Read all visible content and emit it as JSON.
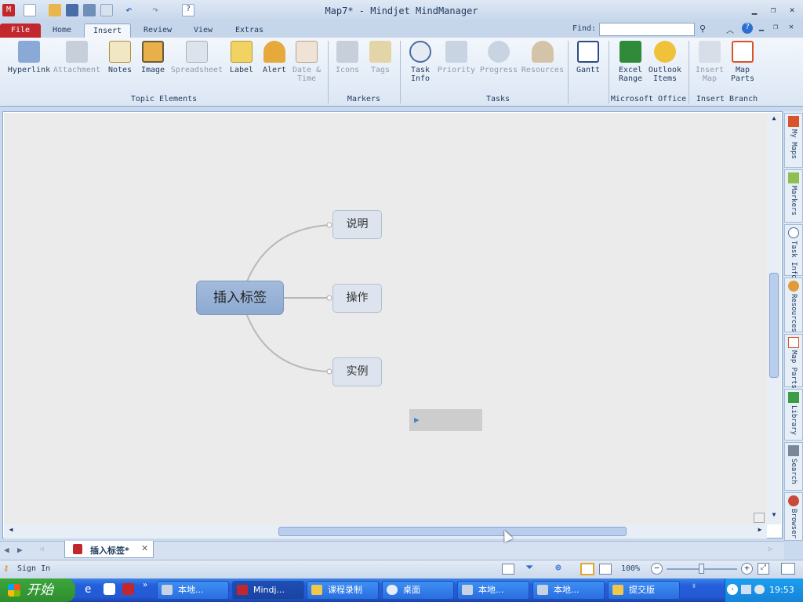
{
  "window": {
    "title": "Map7* - Mindjet MindManager",
    "find_label": "Find:",
    "find_value": ""
  },
  "tabs": [
    {
      "label": "File"
    },
    {
      "label": "Home"
    },
    {
      "label": "Insert"
    },
    {
      "label": "Review"
    },
    {
      "label": "View"
    },
    {
      "label": "Extras"
    }
  ],
  "ribbon": {
    "buttons": [
      {
        "label": "Hyperlink",
        "icon": "chain-link-icon",
        "enabled": true
      },
      {
        "label": "Attachment",
        "icon": "paperclip-icon",
        "enabled": false
      },
      {
        "label": "Notes",
        "icon": "notepad-icon",
        "enabled": true
      },
      {
        "label": "Image",
        "icon": "picture-icon",
        "enabled": true
      },
      {
        "label": "Spreadsheet",
        "icon": "grid-icon",
        "enabled": false
      },
      {
        "label": "Label",
        "icon": "tag-label-icon",
        "enabled": true
      },
      {
        "label": "Alert",
        "icon": "bell-icon",
        "enabled": true
      },
      {
        "label": "Date &",
        "label2": "Time",
        "icon": "calendar-clock-icon",
        "enabled": false
      },
      {
        "label": "Icons",
        "icon": "signpost-icon",
        "enabled": false
      },
      {
        "label": "Tags",
        "icon": "sticky-tag-icon",
        "enabled": false
      },
      {
        "label": "Task",
        "label2": "Info",
        "icon": "clock-check-icon",
        "enabled": true
      },
      {
        "label": "Priority",
        "icon": "priority-numbers-icon",
        "enabled": false
      },
      {
        "label": "Progress",
        "icon": "progress-check-icon",
        "enabled": false
      },
      {
        "label": "Resources",
        "icon": "person-icon",
        "enabled": false
      },
      {
        "label": "Gantt",
        "icon": "gantt-chart-icon",
        "enabled": true
      },
      {
        "label": "Excel",
        "label2": "Range",
        "icon": "excel-icon",
        "enabled": true
      },
      {
        "label": "Outlook",
        "label2": "Items",
        "icon": "outlook-icon",
        "enabled": true
      },
      {
        "label": "Insert",
        "label2": "Map",
        "icon": "insert-map-icon",
        "enabled": false
      },
      {
        "label": "Map",
        "label2": "Parts",
        "icon": "map-parts-icon",
        "enabled": true
      }
    ],
    "groups": [
      "Topic Elements",
      "Markers",
      "Tasks",
      "Microsoft Office",
      "Insert Branch"
    ]
  },
  "map": {
    "central": "插入标签",
    "subtopics": [
      "说明",
      "操作",
      "实例"
    ]
  },
  "side_panel": [
    "My Maps",
    "Markers",
    "Task Info",
    "Resources",
    "Map Parts",
    "Library",
    "Search",
    "Browser"
  ],
  "doc_tab": {
    "label": "插入标签*"
  },
  "status": {
    "sign_in": "Sign In",
    "zoom": "100%",
    "zoom_level": 0.6
  },
  "taskbar": {
    "start": "开始",
    "items": [
      "本地...",
      "Mindj...",
      "课程录制",
      "桌面",
      "本地...",
      "本地...",
      "提交版"
    ],
    "clock": "19:53"
  },
  "colors": {
    "file_tab": "#c1272d",
    "central_topic": "#8eaad2",
    "taskbar": "#245edb"
  }
}
